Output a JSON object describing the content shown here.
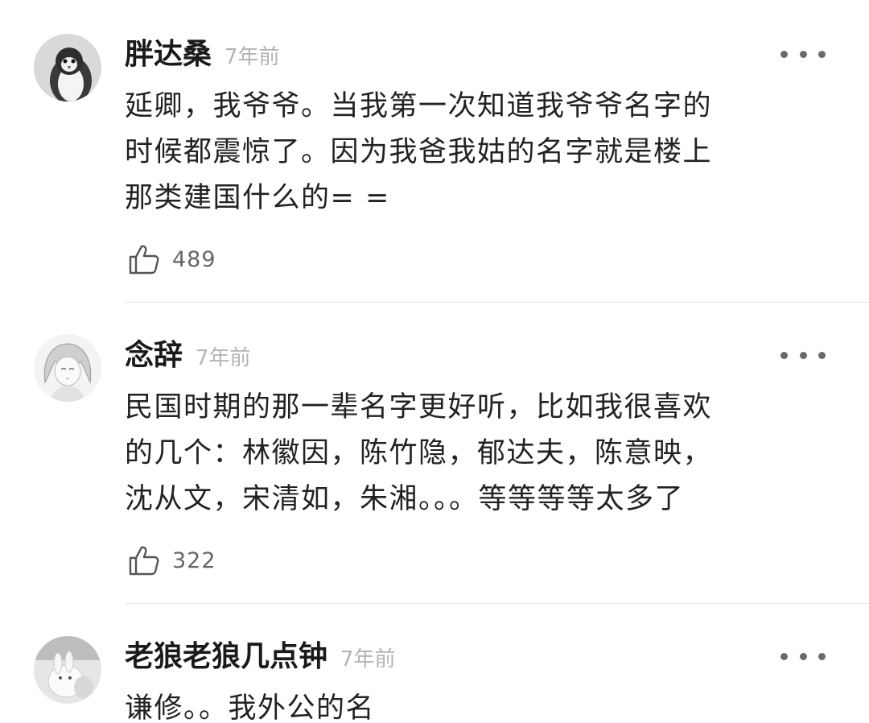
{
  "comments": [
    {
      "username": "胖达桑",
      "time": "7年前",
      "avatar_icon": "penguin-avatar-icon",
      "lines": [
        "延卿，我爷爷。当我第一次知道我爷爷名字的",
        "时候都震惊了。因为我爸我姑的名字就是楼上",
        "那类建国什么的= ="
      ],
      "likes": "489"
    },
    {
      "username": "念辞",
      "time": "7年前",
      "avatar_icon": "anime-girl-avatar-icon",
      "lines": [
        "民国时期的那一辈名字更好听，比如我很喜欢",
        "的几个：林徽因，陈竹隐，郁达夫，陈意映，",
        "沈从文，宋清如，朱湘。。。等等等等太多了"
      ],
      "likes": "322"
    },
    {
      "username": "老狼老狼几点钟",
      "time": "7年前",
      "avatar_icon": "bunny-avatar-icon",
      "lines": [
        "谦修。。我外公的名"
      ]
    }
  ],
  "colors": {
    "username": "#1a1a1a",
    "time": "#b3b3b3",
    "text": "#222222",
    "like_count": "#666666",
    "divider": "#e5e5e5"
  }
}
